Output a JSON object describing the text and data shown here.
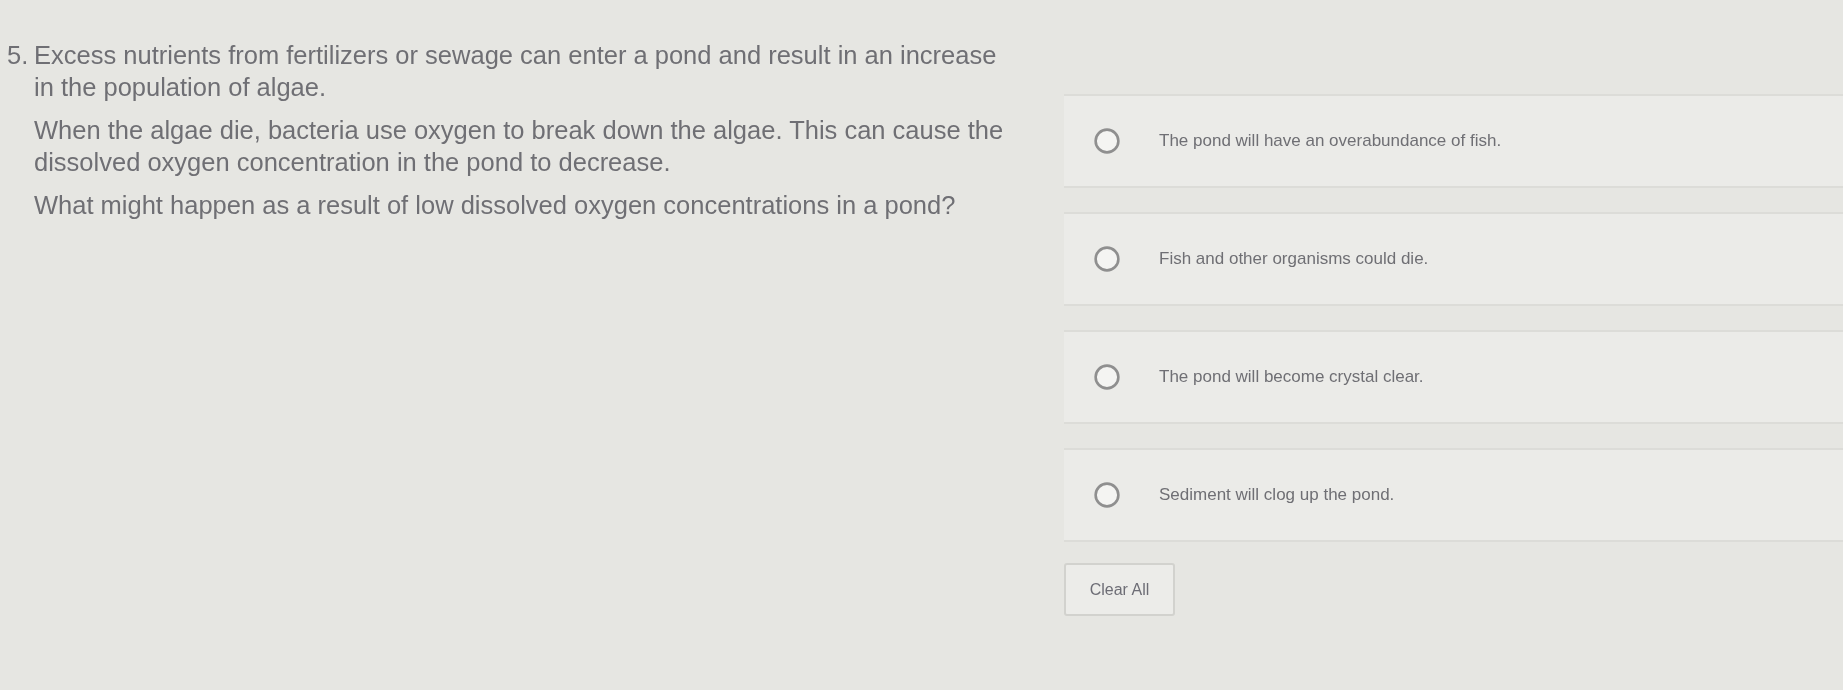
{
  "question": {
    "number": "5.",
    "paragraphs": [
      "Excess nutrients from fertilizers or sewage can enter a pond and result in an increase in the population of algae.",
      "When the algae die, bacteria use oxygen to break down the algae. This can cause the dissolved oxygen concentration in the pond to decrease.",
      "What might happen as a result of low dissolved oxygen concentrations in a pond?"
    ]
  },
  "options": [
    {
      "label": "The pond will have an overabundance of fish.",
      "selected": false
    },
    {
      "label": "Fish and other organisms could die.",
      "selected": false
    },
    {
      "label": "The pond will become crystal clear.",
      "selected": false
    },
    {
      "label": "Sediment will clog up the pond.",
      "selected": false
    }
  ],
  "buttons": [
    {
      "label": "Clear All"
    }
  ]
}
